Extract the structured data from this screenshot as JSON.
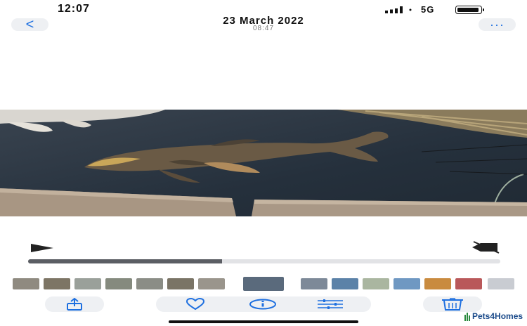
{
  "status_bar": {
    "time": "12:07",
    "network": "5G",
    "signal_icon": "signal-bars-icon",
    "battery_icon": "battery-icon"
  },
  "nav": {
    "back_label": "<",
    "title": "23 March 2022",
    "subtitle": "08:47",
    "more_label": "···"
  },
  "photo": {
    "subject": "koi-fish-pond"
  },
  "playback": {
    "progress": 0.41,
    "play_icon": "play-icon",
    "mute_icon": "speaker-muted-icon"
  },
  "filmstrip": {
    "thumbnails": [
      {
        "color": "#8f8a80"
      },
      {
        "color": "#7d7565"
      },
      {
        "color": "#9aa09a"
      },
      {
        "color": "#858a7e"
      },
      {
        "color": "#8b8d86"
      },
      {
        "color": "#7a7466"
      },
      {
        "color": "#9a958c"
      },
      {
        "color": "#5a6a7c"
      },
      {
        "color": "#7d8998"
      },
      {
        "color": "#5b82a8"
      },
      {
        "color": "#aab6a0"
      },
      {
        "color": "#6f98c2"
      },
      {
        "color": "#c98b3f"
      },
      {
        "color": "#b9585a"
      },
      {
        "color": "#c9ccd2"
      }
    ]
  },
  "toolbar": {
    "share_icon": "share-icon",
    "favorite_icon": "heart-icon",
    "info_icon": "info-icon",
    "adjust_icon": "sliders-icon",
    "delete_icon": "trash-icon"
  },
  "watermark": {
    "text": "Pets4Homes"
  },
  "colors": {
    "accent": "#1d6fe0",
    "pill": "#eef0f3"
  }
}
